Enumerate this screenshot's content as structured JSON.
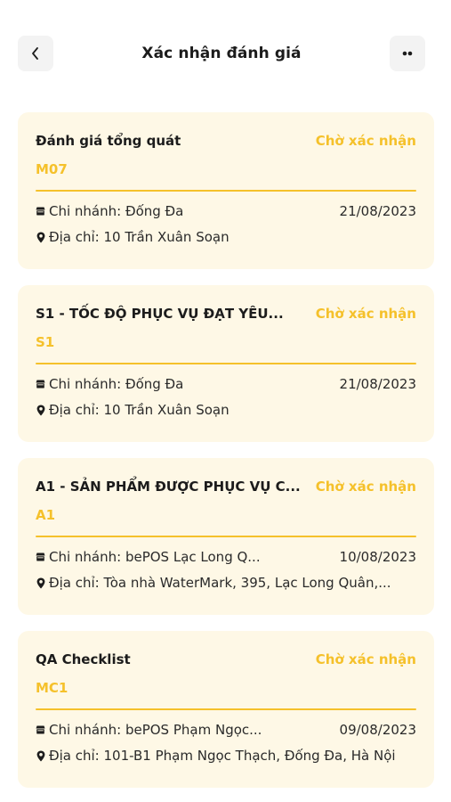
{
  "header": {
    "title": "Xác nhận đánh giá",
    "back_icon": "chevron-left-icon",
    "more_icon": "more-dots-icon"
  },
  "colors": {
    "accent": "#f5c12b",
    "card_bg": "#fef8e6",
    "text": "#1c1c1c"
  },
  "items": [
    {
      "title": "Đánh giá tổng quát",
      "status": "Chờ xác nhận",
      "code": "M07",
      "branch": "Chi nhánh: Đống Đa",
      "date": "21/08/2023",
      "address": "Địa chỉ: 10 Trần Xuân Soạn"
    },
    {
      "title": "S1 - TỐC ĐỘ  PHỤC VỤ ĐẠT YÊU...",
      "status": "Chờ xác nhận",
      "code": "S1",
      "branch": "Chi nhánh: Đống Đa",
      "date": "21/08/2023",
      "address": "Địa chỉ: 10 Trần Xuân Soạn"
    },
    {
      "title": "A1 - SẢN PHẨM ĐƯỢC PHỤC VỤ C...",
      "status": "Chờ xác nhận",
      "code": "A1",
      "branch": "Chi nhánh: bePOS Lạc Long Q...",
      "date": "10/08/2023",
      "address": "Địa chỉ: Tòa nhà WaterMark, 395, Lạc Long Quân,..."
    },
    {
      "title": "QA Checklist",
      "status": "Chờ xác nhận",
      "code": "MC1",
      "branch": "Chi nhánh: bePOS Phạm Ngọc...",
      "date": "09/08/2023",
      "address": "Địa chỉ: 101-B1 Phạm Ngọc Thạch, Đống Đa, Hà Nội"
    }
  ]
}
